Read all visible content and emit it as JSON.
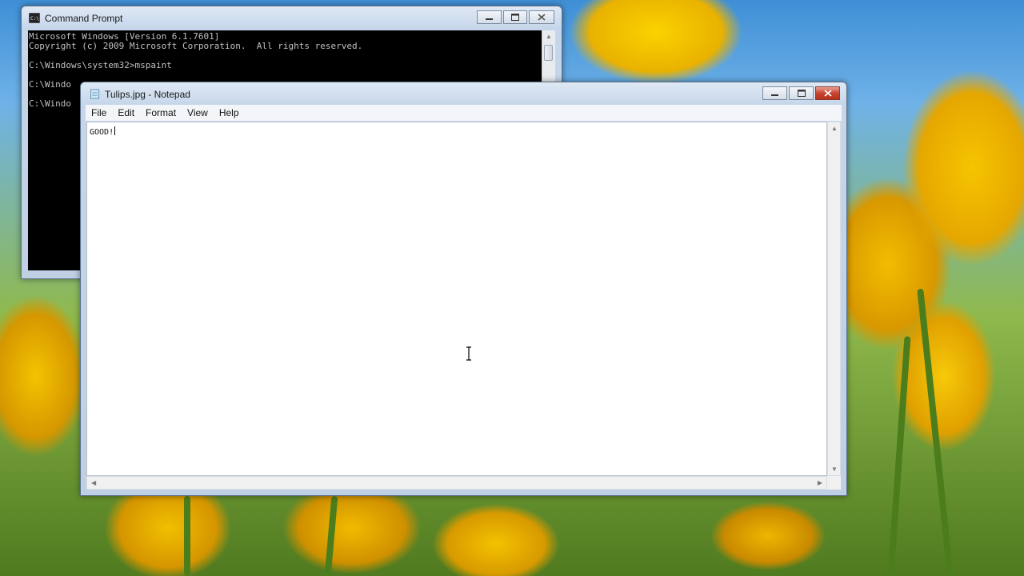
{
  "desktop": {
    "wallpaper": "tulips",
    "accent": "#f2bd00"
  },
  "cmd_window": {
    "title": "Command Prompt",
    "icon": "console-icon",
    "lines": [
      "Microsoft Windows [Version 6.1.7601]",
      "Copyright (c) 2009 Microsoft Corporation.  All rights reserved.",
      "",
      "C:\\Windows\\system32>mspaint",
      "",
      "C:\\Windo",
      "",
      "C:\\Windo"
    ]
  },
  "notepad": {
    "title": "Tulips.jpg - Notepad",
    "icon": "notepad-icon",
    "menu": [
      "File",
      "Edit",
      "Format",
      "View",
      "Help"
    ],
    "content": "GOOD!"
  }
}
